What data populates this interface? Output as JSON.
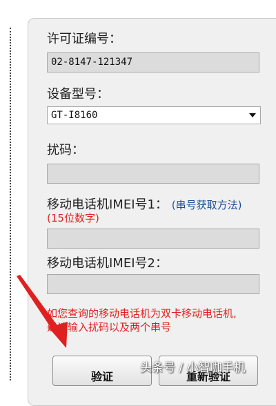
{
  "form": {
    "license_label": "许可证编号：",
    "license_value": "02-8147-121347",
    "model_label": "设备型号：",
    "model_value": "GT-I8160",
    "scramble_label": "扰码：",
    "scramble_value": "",
    "imei1_label": "移动电话机IMEI号1：",
    "imei1_link": "(串号获取方法)",
    "imei1_hint": "(15位数字)",
    "imei1_value": "",
    "imei2_label": "移动电话机IMEI号2：",
    "imei2_value": "",
    "notice_line1": "如您查询的移动电话机为双卡移动电话机,",
    "notice_line2": "建议输入扰码以及两个串号"
  },
  "buttons": {
    "verify": "验证",
    "reverify": "重新验证"
  },
  "watermark": "头条号 / 小智咖手机",
  "colors": {
    "annotation_arrow": "#e02020",
    "notice_text": "#e02020",
    "link_text": "#1f4f9a"
  }
}
